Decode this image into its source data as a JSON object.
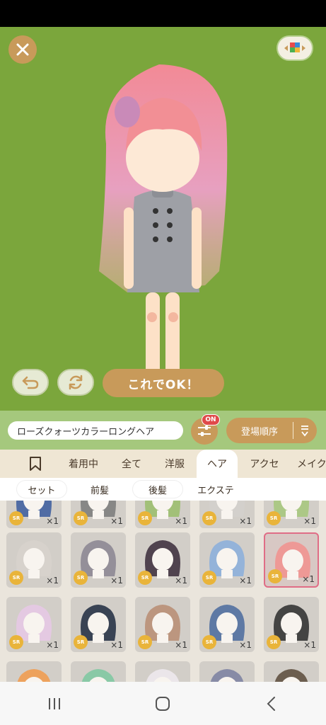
{
  "stage": {
    "ok_label": "これでOK！"
  },
  "info": {
    "item_name": "ローズクォーツカラーロングヘア",
    "filter_badge": "ON",
    "sort_label": "登場順序"
  },
  "tabs": [
    {
      "label": "着用中"
    },
    {
      "label": "全て"
    },
    {
      "label": "洋服"
    },
    {
      "label": "ヘア"
    },
    {
      "label": "アクセ"
    },
    {
      "label": "メイク"
    }
  ],
  "subtabs": [
    {
      "label": "セット"
    },
    {
      "label": "前髪"
    },
    {
      "label": "後髪"
    },
    {
      "label": "エクステ"
    }
  ],
  "grid": {
    "rarity": "SR",
    "quantity": "×1",
    "rows": [
      [
        {
          "hair": "#3a5a9e"
        },
        {
          "hair": "#7a7a7a"
        },
        {
          "hair": "#9abd6a"
        },
        {
          "hair": "#d4d0cc"
        },
        {
          "hair": "#a6c77a"
        }
      ],
      [
        {
          "hair": "#d8d2cc"
        },
        {
          "hair": "#8a8490"
        },
        {
          "hair": "#3a2a3a"
        },
        {
          "hair": "#8aaedc"
        },
        {
          "hair": "#f2918e"
        }
      ],
      [
        {
          "hair": "#e7c8e6"
        },
        {
          "hair": "#1f2a40"
        },
        {
          "hair": "#b88c72"
        },
        {
          "hair": "#4a6a9e"
        },
        {
          "hair": "#2b2b2b"
        }
      ],
      [
        {
          "hair": "#f29a4a"
        },
        {
          "hair": "#7cc8a0"
        },
        {
          "hair": "#f0eaf0"
        },
        {
          "hair": "#7a7fa0"
        },
        {
          "hair": "#5a4a3a"
        }
      ]
    ]
  },
  "colors": {
    "stage_bg": "#7ba63c",
    "accent": "#c89a5a",
    "selected_border": "#e06d86"
  }
}
